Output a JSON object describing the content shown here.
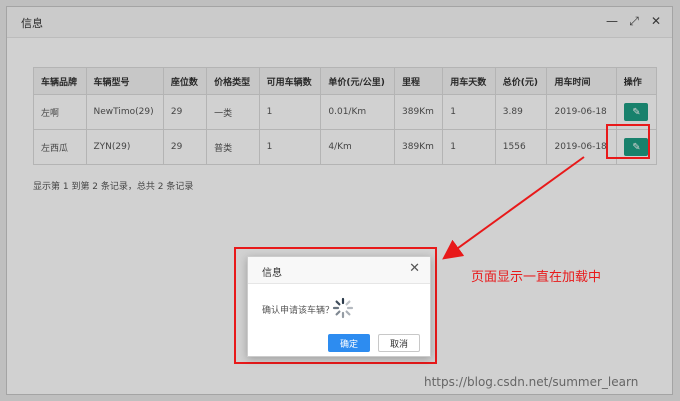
{
  "layer": {
    "title": "信息"
  },
  "window_controls": {
    "minimize": "—",
    "maximize": "⤢",
    "close": "✕"
  },
  "table": {
    "headers": [
      "车辆品牌",
      "车辆型号",
      "座位数",
      "价格类型",
      "可用车辆数",
      "单价(元/公里)",
      "里程",
      "用车天数",
      "总价(元)",
      "用车时间",
      "操作"
    ],
    "rows": [
      [
        "左啊",
        "NewTimo(29)",
        "29",
        "一类",
        "1",
        "0.01/Km",
        "389Km",
        "1",
        "3.89",
        "2019-06-18"
      ],
      [
        "左西瓜",
        "ZYN(29)",
        "29",
        "普类",
        "1",
        "4/Km",
        "389Km",
        "1",
        "1556",
        "2019-06-18"
      ]
    ]
  },
  "footer_text": "显示第 1 到第 2 条记录，总共 2 条记录",
  "dialog": {
    "title": "信息",
    "close": "✕",
    "message": "确认申请该车辆？",
    "ok_label": "确定",
    "cancel_label": "取消"
  },
  "annotation": "页面显示一直在加载中",
  "watermark": "https://blog.csdn.net/summer_learn",
  "colors": {
    "accent_green": "#1e9e84",
    "primary_blue": "#2d8cf0",
    "annotation_red": "#e8191a"
  }
}
